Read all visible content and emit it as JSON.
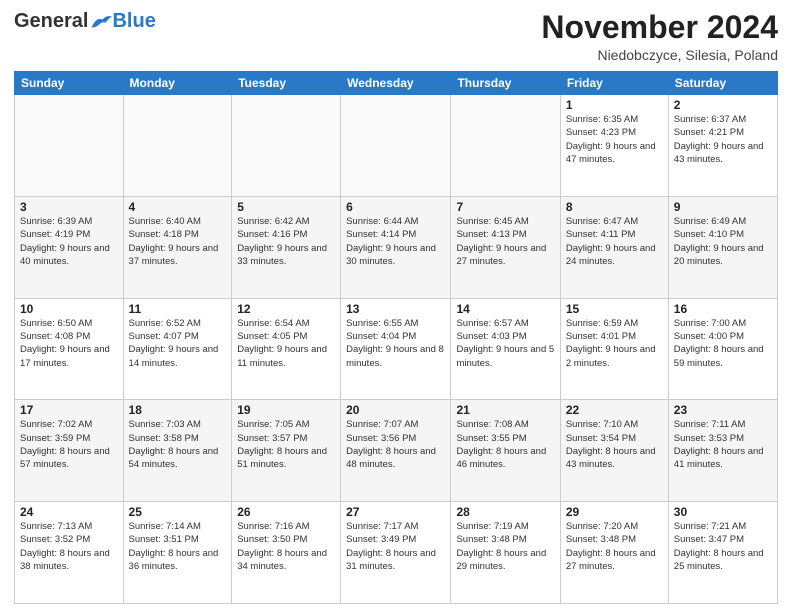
{
  "logo": {
    "general": "General",
    "blue": "Blue"
  },
  "header": {
    "month_year": "November 2024",
    "location": "Niedobczyce, Silesia, Poland"
  },
  "days_of_week": [
    "Sunday",
    "Monday",
    "Tuesday",
    "Wednesday",
    "Thursday",
    "Friday",
    "Saturday"
  ],
  "weeks": [
    [
      {
        "day": "",
        "info": ""
      },
      {
        "day": "",
        "info": ""
      },
      {
        "day": "",
        "info": ""
      },
      {
        "day": "",
        "info": ""
      },
      {
        "day": "",
        "info": ""
      },
      {
        "day": "1",
        "info": "Sunrise: 6:35 AM\nSunset: 4:23 PM\nDaylight: 9 hours\nand 47 minutes."
      },
      {
        "day": "2",
        "info": "Sunrise: 6:37 AM\nSunset: 4:21 PM\nDaylight: 9 hours\nand 43 minutes."
      }
    ],
    [
      {
        "day": "3",
        "info": "Sunrise: 6:39 AM\nSunset: 4:19 PM\nDaylight: 9 hours\nand 40 minutes."
      },
      {
        "day": "4",
        "info": "Sunrise: 6:40 AM\nSunset: 4:18 PM\nDaylight: 9 hours\nand 37 minutes."
      },
      {
        "day": "5",
        "info": "Sunrise: 6:42 AM\nSunset: 4:16 PM\nDaylight: 9 hours\nand 33 minutes."
      },
      {
        "day": "6",
        "info": "Sunrise: 6:44 AM\nSunset: 4:14 PM\nDaylight: 9 hours\nand 30 minutes."
      },
      {
        "day": "7",
        "info": "Sunrise: 6:45 AM\nSunset: 4:13 PM\nDaylight: 9 hours\nand 27 minutes."
      },
      {
        "day": "8",
        "info": "Sunrise: 6:47 AM\nSunset: 4:11 PM\nDaylight: 9 hours\nand 24 minutes."
      },
      {
        "day": "9",
        "info": "Sunrise: 6:49 AM\nSunset: 4:10 PM\nDaylight: 9 hours\nand 20 minutes."
      }
    ],
    [
      {
        "day": "10",
        "info": "Sunrise: 6:50 AM\nSunset: 4:08 PM\nDaylight: 9 hours\nand 17 minutes."
      },
      {
        "day": "11",
        "info": "Sunrise: 6:52 AM\nSunset: 4:07 PM\nDaylight: 9 hours\nand 14 minutes."
      },
      {
        "day": "12",
        "info": "Sunrise: 6:54 AM\nSunset: 4:05 PM\nDaylight: 9 hours\nand 11 minutes."
      },
      {
        "day": "13",
        "info": "Sunrise: 6:55 AM\nSunset: 4:04 PM\nDaylight: 9 hours\nand 8 minutes."
      },
      {
        "day": "14",
        "info": "Sunrise: 6:57 AM\nSunset: 4:03 PM\nDaylight: 9 hours\nand 5 minutes."
      },
      {
        "day": "15",
        "info": "Sunrise: 6:59 AM\nSunset: 4:01 PM\nDaylight: 9 hours\nand 2 minutes."
      },
      {
        "day": "16",
        "info": "Sunrise: 7:00 AM\nSunset: 4:00 PM\nDaylight: 8 hours\nand 59 minutes."
      }
    ],
    [
      {
        "day": "17",
        "info": "Sunrise: 7:02 AM\nSunset: 3:59 PM\nDaylight: 8 hours\nand 57 minutes."
      },
      {
        "day": "18",
        "info": "Sunrise: 7:03 AM\nSunset: 3:58 PM\nDaylight: 8 hours\nand 54 minutes."
      },
      {
        "day": "19",
        "info": "Sunrise: 7:05 AM\nSunset: 3:57 PM\nDaylight: 8 hours\nand 51 minutes."
      },
      {
        "day": "20",
        "info": "Sunrise: 7:07 AM\nSunset: 3:56 PM\nDaylight: 8 hours\nand 48 minutes."
      },
      {
        "day": "21",
        "info": "Sunrise: 7:08 AM\nSunset: 3:55 PM\nDaylight: 8 hours\nand 46 minutes."
      },
      {
        "day": "22",
        "info": "Sunrise: 7:10 AM\nSunset: 3:54 PM\nDaylight: 8 hours\nand 43 minutes."
      },
      {
        "day": "23",
        "info": "Sunrise: 7:11 AM\nSunset: 3:53 PM\nDaylight: 8 hours\nand 41 minutes."
      }
    ],
    [
      {
        "day": "24",
        "info": "Sunrise: 7:13 AM\nSunset: 3:52 PM\nDaylight: 8 hours\nand 38 minutes."
      },
      {
        "day": "25",
        "info": "Sunrise: 7:14 AM\nSunset: 3:51 PM\nDaylight: 8 hours\nand 36 minutes."
      },
      {
        "day": "26",
        "info": "Sunrise: 7:16 AM\nSunset: 3:50 PM\nDaylight: 8 hours\nand 34 minutes."
      },
      {
        "day": "27",
        "info": "Sunrise: 7:17 AM\nSunset: 3:49 PM\nDaylight: 8 hours\nand 31 minutes."
      },
      {
        "day": "28",
        "info": "Sunrise: 7:19 AM\nSunset: 3:48 PM\nDaylight: 8 hours\nand 29 minutes."
      },
      {
        "day": "29",
        "info": "Sunrise: 7:20 AM\nSunset: 3:48 PM\nDaylight: 8 hours\nand 27 minutes."
      },
      {
        "day": "30",
        "info": "Sunrise: 7:21 AM\nSunset: 3:47 PM\nDaylight: 8 hours\nand 25 minutes."
      }
    ]
  ]
}
